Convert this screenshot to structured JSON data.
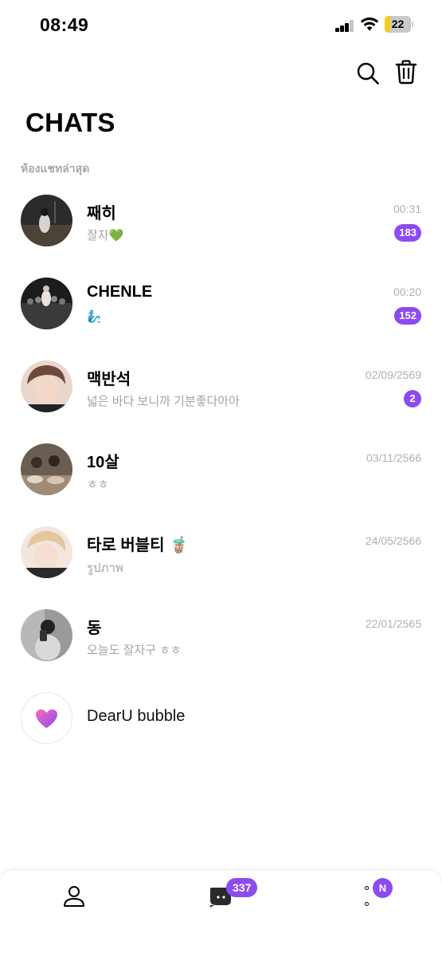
{
  "status_bar": {
    "time": "08:49",
    "battery_level": "22"
  },
  "header": {
    "title": "CHATS",
    "search_icon": "search-icon",
    "trash_icon": "trash-icon"
  },
  "section": {
    "label": "ห้องแชทล่าสุด"
  },
  "chats": [
    {
      "name": "째히",
      "preview": "잘자💚",
      "time": "00:31",
      "badge": "183",
      "avatar_color": "#2b2b2b"
    },
    {
      "name": "CHENLE",
      "preview": "🧞‍♂️",
      "time": "00:20",
      "badge": "152",
      "avatar_color": "#1c1c1c"
    },
    {
      "name": "맥반석",
      "preview": "넓은 바다 보니까 기분좋다아아",
      "time": "02/09/2569",
      "badge": "2",
      "avatar_color": "#c9a48a"
    },
    {
      "name": "10살",
      "preview": "ㅎㅎ",
      "time": "03/11/2566",
      "badge": "",
      "avatar_color": "#5a4d44"
    },
    {
      "name": "타로 버블티 🧋",
      "preview": "รูปภาพ",
      "time": "24/05/2566",
      "badge": "",
      "avatar_color": "#d9b8a8"
    },
    {
      "name": "동",
      "preview": "오늘도 잘자구 ㅎㅎ",
      "time": "22/01/2565",
      "badge": "",
      "avatar_color": "#8a8a8a"
    }
  ],
  "bubble": {
    "name": "DearU bubble",
    "icon": "heart-icon"
  },
  "bottom_nav": {
    "profile_icon": "person-icon",
    "chat_icon": "chat-bubble-icon",
    "chat_badge": "337",
    "more_icon": "more-icon",
    "more_badge": "N"
  },
  "colors": {
    "accent": "#8e4af1",
    "muted_text": "#a4a4a4"
  }
}
